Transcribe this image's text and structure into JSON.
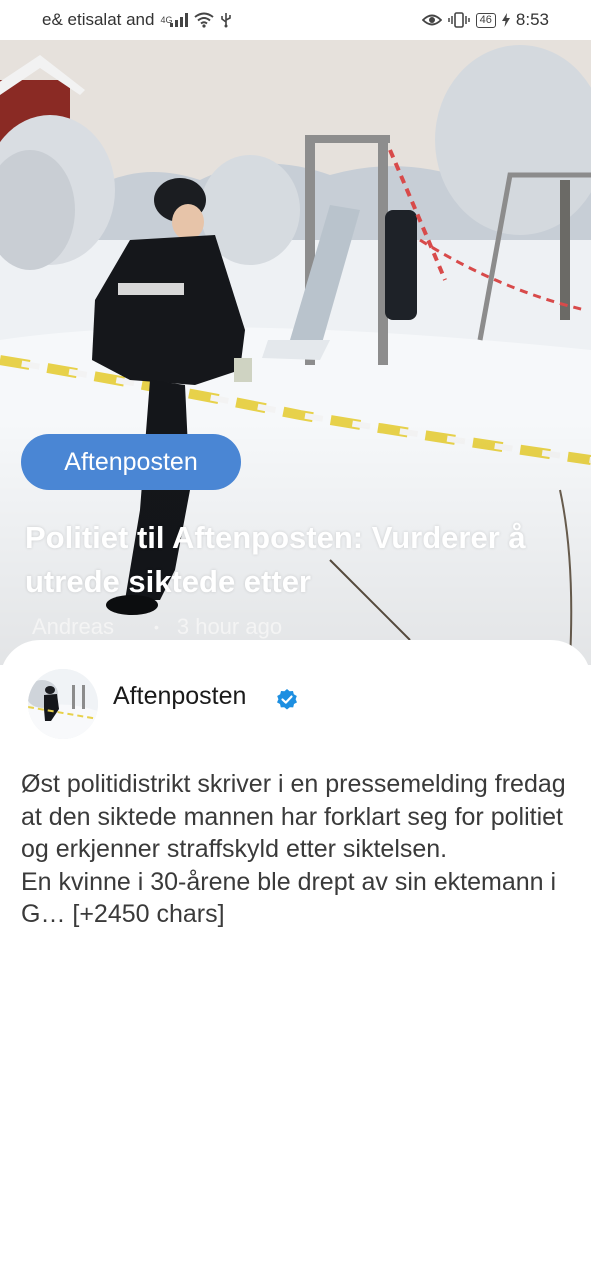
{
  "status_bar": {
    "carrier": "e& etisalat and",
    "network_type": "4G",
    "battery_level": "46",
    "time": "8:53",
    "icons": [
      "signal-icon",
      "wifi-icon",
      "usb-icon",
      "eye-icon",
      "vibrate-icon",
      "battery-icon",
      "charging-icon"
    ]
  },
  "article": {
    "source_label": "Aftenposten",
    "headline": "Politiet til Aftenposten: Vurderer å utrede siktede etter",
    "author": "Andreas",
    "separator": "•",
    "time_ago": "3 hour ago"
  },
  "publisher": {
    "name": "Aftenposten",
    "verified_icon": "verified-check-icon"
  },
  "body": {
    "paragraph_1": "Øst politidistrikt skriver i en pressemelding fredag at den siktede mannen har forklart seg for politiet og erkjenner straffskyld etter siktelsen.",
    "paragraph_2": "En kvinne i 30-årene ble drept av sin ektemann i G… [+2450 chars]"
  },
  "colors": {
    "pill": "#4a86d4",
    "verified": "#1d8fe1",
    "text": "#3a3a3a"
  }
}
